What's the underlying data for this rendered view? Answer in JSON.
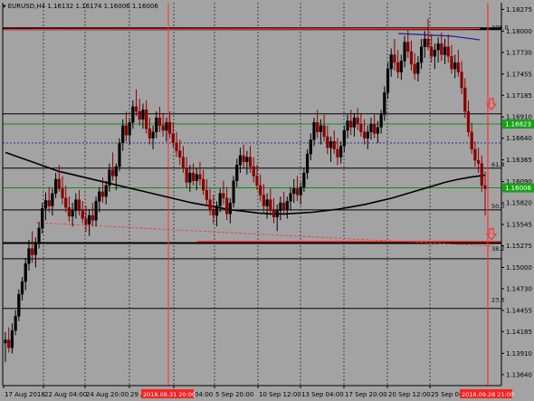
{
  "header": {
    "menu_icon": "triangle-down-icon",
    "symbol_label": "EURUSD,H4",
    "ohlc": [
      "1.16132",
      "1.16174",
      "1.16006",
      "1.16006"
    ]
  },
  "price_axis": {
    "ticks": [
      "1.18275",
      "1.18000",
      "1.17730",
      "1.17455",
      "1.17185",
      "1.16910",
      "1.16640",
      "1.16365",
      "1.16090",
      "1.15820",
      "1.15545",
      "1.15275",
      "1.15000",
      "1.14730",
      "1.14455",
      "1.14185",
      "1.13910",
      "1.13640"
    ],
    "current_price_label": "1.16006",
    "level_price_label": "1.16823"
  },
  "time_axis": {
    "ticks": [
      "17 Aug 2018",
      "22 Aug 04:00",
      "24 Aug 20:00",
      "29 A",
      "3 Sep 04:00",
      "5 Sep 20:00",
      "10 Sep 12:00",
      "13 Sep 04:00",
      "17 Sep 20:00",
      "20 Sep 12:00",
      "25 Sep 04:00"
    ],
    "highlight_left": "2018.08.31 20:00",
    "highlight_right": "2018.09.28 21:00"
  },
  "fib_levels": [
    {
      "label": "100.0",
      "price": 1.18
    },
    {
      "label": "61.8",
      "price": 1.1626
    },
    {
      "label": "50.0",
      "price": 1.1573
    },
    {
      "label": "38.2",
      "price": 1.1519
    },
    {
      "label": "23.6",
      "price": 1.1454
    }
  ],
  "arrow_markers": [
    {
      "icon": "down-arrow-icon",
      "price": 1.1705
    },
    {
      "icon": "down-arrow-icon",
      "price": 1.154
    }
  ],
  "colors": {
    "background": "#a3a3a3",
    "candle_up": "#000000",
    "candle_down": "#8b0000",
    "grid": "#000000",
    "red_line": "#ff3030",
    "green_line": "#109010",
    "blue_dash": "#1e1e9e",
    "price_tag_green": "#18a018",
    "time_tag_red": "#ff2020"
  },
  "chart_data": {
    "type": "candlestick",
    "symbol": "EURUSD",
    "timeframe": "H4",
    "ylim": [
      1.135,
      1.1836
    ],
    "horizontal_levels": {
      "black": [
        1.1803,
        1.1695,
        1.1626,
        1.1573,
        1.1531,
        1.1511,
        1.1448
      ],
      "green": [
        1.1682,
        1.1601
      ],
      "red": [
        1.1802,
        1.1533
      ],
      "blue_dashed": [
        1.1658
      ]
    },
    "candles": [
      [
        1.1404,
        1.1418,
        1.138,
        1.1408
      ],
      [
        1.1408,
        1.1424,
        1.1392,
        1.1398
      ],
      [
        1.1398,
        1.1429,
        1.1391,
        1.142
      ],
      [
        1.142,
        1.1446,
        1.1414,
        1.1438
      ],
      [
        1.1438,
        1.1472,
        1.1432,
        1.1466
      ],
      [
        1.1466,
        1.1488,
        1.1458,
        1.1482
      ],
      [
        1.1482,
        1.1512,
        1.1471,
        1.1505
      ],
      [
        1.1505,
        1.1535,
        1.1496,
        1.1524
      ],
      [
        1.1524,
        1.1546,
        1.1506,
        1.1516
      ],
      [
        1.1516,
        1.1538,
        1.15,
        1.1532
      ],
      [
        1.1532,
        1.1558,
        1.1524,
        1.155
      ],
      [
        1.155,
        1.1582,
        1.1543,
        1.1575
      ],
      [
        1.1575,
        1.1595,
        1.156,
        1.1585
      ],
      [
        1.1585,
        1.1602,
        1.157,
        1.1578
      ],
      [
        1.1578,
        1.16,
        1.1566,
        1.1594
      ],
      [
        1.1594,
        1.162,
        1.1588,
        1.1612
      ],
      [
        1.1612,
        1.163,
        1.1596,
        1.16
      ],
      [
        1.16,
        1.1616,
        1.158,
        1.1588
      ],
      [
        1.1588,
        1.1604,
        1.157,
        1.1576
      ],
      [
        1.1576,
        1.159,
        1.1558,
        1.1565
      ],
      [
        1.1565,
        1.1582,
        1.1552,
        1.1572
      ],
      [
        1.1572,
        1.1594,
        1.1562,
        1.1586
      ],
      [
        1.1586,
        1.1598,
        1.1566,
        1.1572
      ],
      [
        1.1572,
        1.1584,
        1.1556,
        1.1562
      ],
      [
        1.1562,
        1.1578,
        1.1545,
        1.1555
      ],
      [
        1.1555,
        1.1574,
        1.154,
        1.1566
      ],
      [
        1.1566,
        1.1582,
        1.1552,
        1.156
      ],
      [
        1.156,
        1.159,
        1.1552,
        1.1584
      ],
      [
        1.1584,
        1.1602,
        1.157,
        1.1596
      ],
      [
        1.1596,
        1.1614,
        1.1582,
        1.159
      ],
      [
        1.159,
        1.161,
        1.158,
        1.1604
      ],
      [
        1.1604,
        1.1632,
        1.1596,
        1.1624
      ],
      [
        1.1624,
        1.1646,
        1.161,
        1.1616
      ],
      [
        1.1616,
        1.1632,
        1.1598,
        1.1628
      ],
      [
        1.1628,
        1.1664,
        1.1622,
        1.1658
      ],
      [
        1.1658,
        1.1688,
        1.1648,
        1.168
      ],
      [
        1.168,
        1.1698,
        1.166,
        1.1668
      ],
      [
        1.1668,
        1.169,
        1.1656,
        1.1684
      ],
      [
        1.1684,
        1.1712,
        1.1676,
        1.1704
      ],
      [
        1.1704,
        1.1726,
        1.1692,
        1.1698
      ],
      [
        1.1698,
        1.1714,
        1.168,
        1.1688
      ],
      [
        1.1688,
        1.1708,
        1.1676,
        1.17
      ],
      [
        1.17,
        1.1712,
        1.167,
        1.1676
      ],
      [
        1.1676,
        1.169,
        1.1656,
        1.1664
      ],
      [
        1.1664,
        1.168,
        1.165,
        1.1672
      ],
      [
        1.1672,
        1.1698,
        1.1664,
        1.169
      ],
      [
        1.169,
        1.1704,
        1.1672,
        1.168
      ],
      [
        1.168,
        1.1696,
        1.1666,
        1.1674
      ],
      [
        1.1674,
        1.169,
        1.166,
        1.1684
      ],
      [
        1.1684,
        1.1698,
        1.1664,
        1.167
      ],
      [
        1.167,
        1.1684,
        1.1652,
        1.1658
      ],
      [
        1.1658,
        1.1672,
        1.164,
        1.1648
      ],
      [
        1.1648,
        1.1662,
        1.163,
        1.164
      ],
      [
        1.164,
        1.1654,
        1.162,
        1.1626
      ],
      [
        1.1626,
        1.164,
        1.16,
        1.1608
      ],
      [
        1.1608,
        1.163,
        1.1596,
        1.162
      ],
      [
        1.162,
        1.1632,
        1.1604,
        1.161
      ],
      [
        1.161,
        1.1626,
        1.1598,
        1.1618
      ],
      [
        1.1618,
        1.1634,
        1.1604,
        1.1612
      ],
      [
        1.1612,
        1.1624,
        1.1592,
        1.1598
      ],
      [
        1.1598,
        1.1612,
        1.1578,
        1.1586
      ],
      [
        1.1586,
        1.16,
        1.1566,
        1.1574
      ],
      [
        1.1574,
        1.1592,
        1.1556,
        1.1566
      ],
      [
        1.1566,
        1.1584,
        1.1552,
        1.1578
      ],
      [
        1.1578,
        1.16,
        1.157,
        1.1594
      ],
      [
        1.1594,
        1.161,
        1.158,
        1.1588
      ],
      [
        1.1588,
        1.1602,
        1.156,
        1.1568
      ],
      [
        1.1568,
        1.1588,
        1.1556,
        1.1582
      ],
      [
        1.1582,
        1.1616,
        1.1576,
        1.161
      ],
      [
        1.161,
        1.1638,
        1.1602,
        1.163
      ],
      [
        1.163,
        1.1652,
        1.162,
        1.1642
      ],
      [
        1.1642,
        1.1656,
        1.1626,
        1.1634
      ],
      [
        1.1634,
        1.1648,
        1.1618,
        1.164
      ],
      [
        1.164,
        1.1654,
        1.162,
        1.1628
      ],
      [
        1.1628,
        1.164,
        1.1608,
        1.1616
      ],
      [
        1.1616,
        1.163,
        1.1598,
        1.1604
      ],
      [
        1.1604,
        1.1618,
        1.1584,
        1.1592
      ],
      [
        1.1592,
        1.1606,
        1.157,
        1.1578
      ],
      [
        1.1578,
        1.1594,
        1.1562,
        1.1586
      ],
      [
        1.1586,
        1.16,
        1.1566,
        1.1572
      ],
      [
        1.1572,
        1.1588,
        1.1556,
        1.1564
      ],
      [
        1.1564,
        1.158,
        1.1546,
        1.1572
      ],
      [
        1.1572,
        1.159,
        1.156,
        1.1582
      ],
      [
        1.1582,
        1.1596,
        1.1566,
        1.1574
      ],
      [
        1.1574,
        1.159,
        1.1562,
        1.1584
      ],
      [
        1.1584,
        1.1602,
        1.1572,
        1.1594
      ],
      [
        1.1594,
        1.1612,
        1.1582,
        1.16
      ],
      [
        1.16,
        1.1616,
        1.1584,
        1.1592
      ],
      [
        1.1592,
        1.1608,
        1.158,
        1.1602
      ],
      [
        1.1602,
        1.1626,
        1.1596,
        1.162
      ],
      [
        1.162,
        1.165,
        1.1612,
        1.1644
      ],
      [
        1.1644,
        1.167,
        1.1636,
        1.1662
      ],
      [
        1.1662,
        1.169,
        1.1654,
        1.1684
      ],
      [
        1.1684,
        1.17,
        1.1664,
        1.1672
      ],
      [
        1.1672,
        1.1688,
        1.1656,
        1.168
      ],
      [
        1.168,
        1.1694,
        1.166,
        1.1666
      ],
      [
        1.1666,
        1.168,
        1.1644,
        1.1652
      ],
      [
        1.1652,
        1.1666,
        1.1634,
        1.166
      ],
      [
        1.166,
        1.1674,
        1.1644,
        1.165
      ],
      [
        1.165,
        1.1664,
        1.163,
        1.164
      ],
      [
        1.164,
        1.166,
        1.1632,
        1.1654
      ],
      [
        1.1654,
        1.168,
        1.1646,
        1.1674
      ],
      [
        1.1674,
        1.1694,
        1.1664,
        1.1686
      ],
      [
        1.1686,
        1.17,
        1.1668,
        1.1678
      ],
      [
        1.1678,
        1.1696,
        1.1666,
        1.169
      ],
      [
        1.169,
        1.1702,
        1.1674,
        1.1682
      ],
      [
        1.1682,
        1.1696,
        1.1666,
        1.1672
      ],
      [
        1.1672,
        1.1688,
        1.1656,
        1.1664
      ],
      [
        1.1664,
        1.168,
        1.165,
        1.1672
      ],
      [
        1.1672,
        1.169,
        1.1662,
        1.1682
      ],
      [
        1.1682,
        1.1694,
        1.1664,
        1.167
      ],
      [
        1.167,
        1.1686,
        1.1658,
        1.1678
      ],
      [
        1.1678,
        1.17,
        1.167,
        1.1694
      ],
      [
        1.1694,
        1.173,
        1.1686,
        1.1722
      ],
      [
        1.1722,
        1.176,
        1.1714,
        1.1752
      ],
      [
        1.1752,
        1.1778,
        1.1742,
        1.177
      ],
      [
        1.177,
        1.179,
        1.175,
        1.176
      ],
      [
        1.176,
        1.1776,
        1.174,
        1.1748
      ],
      [
        1.1748,
        1.177,
        1.1738,
        1.1762
      ],
      [
        1.1762,
        1.1794,
        1.1754,
        1.1786
      ],
      [
        1.1786,
        1.1802,
        1.1766,
        1.1774
      ],
      [
        1.1774,
        1.1788,
        1.175,
        1.1758
      ],
      [
        1.1758,
        1.1772,
        1.1738,
        1.1746
      ],
      [
        1.1746,
        1.1768,
        1.1736,
        1.176
      ],
      [
        1.176,
        1.179,
        1.1752,
        1.178
      ],
      [
        1.178,
        1.18,
        1.1766,
        1.179
      ],
      [
        1.179,
        1.1816,
        1.1776,
        1.178
      ],
      [
        1.178,
        1.1796,
        1.176,
        1.1768
      ],
      [
        1.1768,
        1.1784,
        1.1752,
        1.1776
      ],
      [
        1.1776,
        1.1792,
        1.176,
        1.1784
      ],
      [
        1.1784,
        1.1798,
        1.1762,
        1.177
      ],
      [
        1.177,
        1.179,
        1.1758,
        1.178
      ],
      [
        1.178,
        1.1796,
        1.176,
        1.1768
      ],
      [
        1.1768,
        1.1782,
        1.1746,
        1.1752
      ],
      [
        1.1752,
        1.177,
        1.174,
        1.176
      ],
      [
        1.176,
        1.1776,
        1.1742,
        1.1748
      ],
      [
        1.1748,
        1.1762,
        1.172,
        1.1728
      ],
      [
        1.1728,
        1.174,
        1.169,
        1.1698
      ],
      [
        1.1698,
        1.1712,
        1.1666,
        1.1672
      ],
      [
        1.1672,
        1.1684,
        1.1644,
        1.165
      ],
      [
        1.165,
        1.166,
        1.1628,
        1.1636
      ],
      [
        1.1636,
        1.1652,
        1.162,
        1.1632
      ],
      [
        1.1632,
        1.1642,
        1.1596,
        1.1604
      ],
      [
        1.1604,
        1.1622,
        1.1566,
        1.16
      ]
    ],
    "moving_average": [
      1.1646,
      1.164,
      1.1634,
      1.1628,
      1.1622,
      1.1618,
      1.1614,
      1.161,
      1.1606,
      1.1602,
      1.1598,
      1.1594,
      1.159,
      1.1586,
      1.1582,
      1.1579,
      1.1576,
      1.1573,
      1.1571,
      1.1569,
      1.1568,
      1.1568,
      1.1569,
      1.157,
      1.1572,
      1.1574,
      1.1577,
      1.158,
      1.1584,
      1.1588,
      1.1593,
      1.1598,
      1.1603,
      1.1608,
      1.1612,
      1.1615,
      1.1617
    ]
  }
}
